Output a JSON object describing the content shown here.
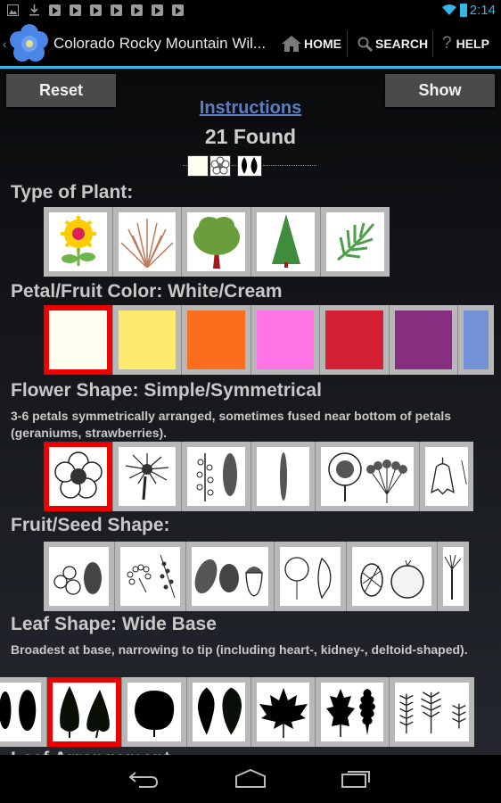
{
  "status_bar": {
    "time": "2:14",
    "icons": [
      "gallery-icon",
      "download-icon",
      "play-store-icon",
      "play-store-icon",
      "play-store-icon",
      "play-store-icon",
      "play-store-icon",
      "play-store-icon",
      "play-store-icon",
      "wifi-icon",
      "battery-charging-icon"
    ]
  },
  "action_bar": {
    "title": "Colorado Rocky Mountain Wil...",
    "home_label": "HOME",
    "search_label": "SEARCH",
    "help_label": "HELP",
    "accent": "#33b5e5"
  },
  "toolbar": {
    "reset_label": "Reset",
    "show_label": "Show",
    "instructions_label": "Instructions",
    "found_text": "21 Found"
  },
  "selection_indicator": [
    "white-cream-swatch",
    "simple-symmetrical-flower",
    "wide-base-leaves"
  ],
  "sections": {
    "plant_type": {
      "label": "Type of Plant:",
      "options": [
        "Wildflower",
        "Shrub",
        "Broadleaf Tree",
        "Conifer",
        "Fern"
      ]
    },
    "petal_color": {
      "label": "Petal/Fruit Color:  White/Cream",
      "selected": "White/Cream",
      "options": [
        {
          "name": "white-cream",
          "color": "#fffff0",
          "selected": true
        },
        {
          "name": "yellow",
          "color": "#ffe96e",
          "selected": false
        },
        {
          "name": "orange",
          "color": "#fb6e1e",
          "selected": false
        },
        {
          "name": "pink",
          "color": "#ff74e4",
          "selected": false
        },
        {
          "name": "red",
          "color": "#d32034",
          "selected": false
        },
        {
          "name": "purple",
          "color": "#862f81",
          "selected": false
        },
        {
          "name": "blue",
          "color": "#7493d6",
          "selected": false
        }
      ]
    },
    "flower_shape": {
      "label": "Flower Shape:  Simple/Symmetrical",
      "selected": "Simple/Symmetrical",
      "description": "3-6 petals symmetrically arranged, sometimes fused near bottom of petals (geraniums, strawberries).",
      "options": [
        "simple-symmetrical",
        "composite",
        "spike-raceme",
        "narrow-spike",
        "head-umbel",
        "bell"
      ]
    },
    "fruit_shape": {
      "label": "Fruit/Seed Shape:",
      "options": [
        "berries",
        "clusters",
        "cones-nuts",
        "capsules-pods",
        "cone-round",
        "plumed"
      ]
    },
    "leaf_shape": {
      "label": "Leaf Shape:  Wide Base",
      "selected": "Wide Base",
      "description": "Broadest at base, narrowing to tip (including heart-, kidney-, deltoid-shaped).",
      "options": [
        "narrow-oval",
        "wide-base",
        "round",
        "wide-tip",
        "palmate-lobed",
        "pinnate-lobed",
        "compound"
      ]
    }
  },
  "nav_bar": [
    "back-button",
    "home-button",
    "recent-apps-button"
  ]
}
